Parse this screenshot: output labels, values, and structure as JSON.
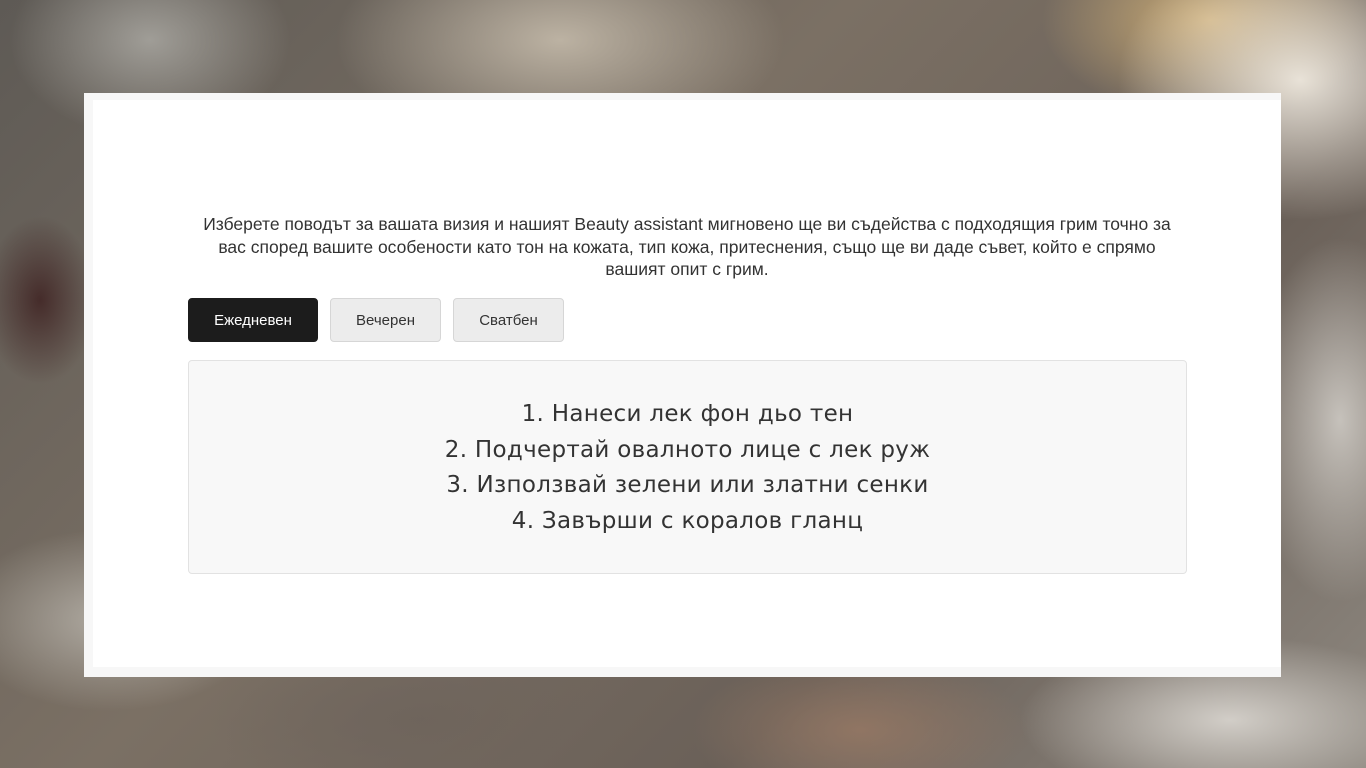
{
  "intro": {
    "text": "Изберете поводът за вашата визия и нашият Beauty assistant мигновено ще ви съдейства с подходящия грим точно за вас според вашите особености като тон на кожата, тип кожа, притеснения, също ще ви даде съвет, който е спрямо вашият опит с грим."
  },
  "tabs": [
    {
      "label": "Ежедневен",
      "active": true
    },
    {
      "label": "Вечерен",
      "active": false
    },
    {
      "label": "Сватбен",
      "active": false
    }
  ],
  "steps": [
    "1. Нанеси лек фон дьо тен",
    "2. Подчертай овалното лице с лек руж",
    "3. Използвай зелени или златни сенки",
    "4. Завърши с коралов гланц"
  ],
  "colors": {
    "active_tab": "#1c1c1c",
    "inactive_tab": "#ececec",
    "steps_box": "#f8f8f8",
    "text": "#333333"
  }
}
